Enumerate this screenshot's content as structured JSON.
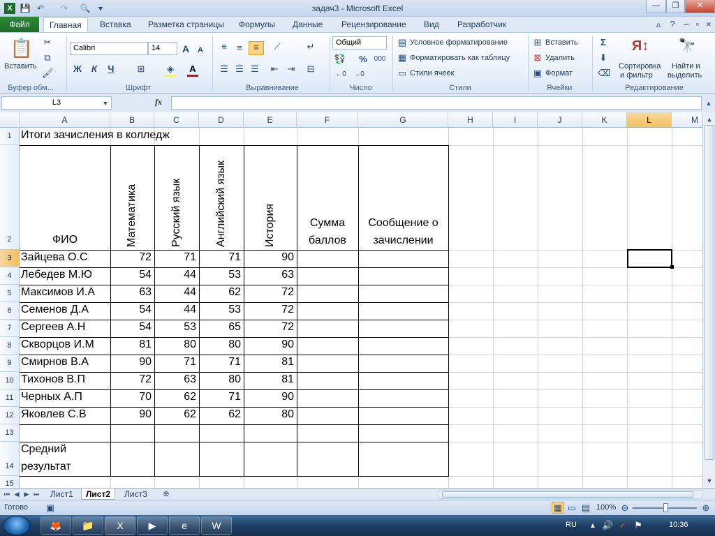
{
  "window": {
    "title": "задач3 - Microsoft Excel",
    "minimize": "—",
    "restore": "❐",
    "close": "✕"
  },
  "ribbon_tabs": [
    "Файл",
    "Главная",
    "Вставка",
    "Разметка страницы",
    "Формулы",
    "Данные",
    "Рецензирование",
    "Вид",
    "Разработчик"
  ],
  "ribbon": {
    "paste_label": "Вставить",
    "clipboard_group": "Буфер обм...",
    "font_name": "Calibri",
    "font_size": "14",
    "grow_font": "A",
    "shrink_font": "A",
    "bold": "Ж",
    "italic": "К",
    "underline": "Ч",
    "font_group": "Шрифт",
    "alignment_group": "Выравнивание",
    "number_format": "Общий",
    "percent": "%",
    "thousands": "000",
    "number_group": "Число",
    "conditional_formatting": "Условное форматирование",
    "format_as_table": "Форматировать как таблицу",
    "cell_styles": "Стили ячеек",
    "styles_group": "Стили",
    "insert_cells": "Вставить",
    "delete_cells": "Удалить",
    "format_cells": "Формат",
    "cells_group": "Ячейки",
    "sort_filter_l1": "Сортировка",
    "sort_filter_l2": "и фильтр",
    "find_select_l1": "Найти и",
    "find_select_l2": "выделить",
    "editing_group": "Редактирование"
  },
  "formula_bar": {
    "name_box": "L3",
    "fx": "fx",
    "value": ""
  },
  "columns": [
    "A",
    "B",
    "C",
    "D",
    "E",
    "F",
    "G",
    "H",
    "I",
    "J",
    "K",
    "L",
    "M"
  ],
  "selected_column": "L",
  "rows": [
    "1",
    "2",
    "3",
    "4",
    "5",
    "6",
    "7",
    "8",
    "9",
    "10",
    "11",
    "12",
    "13",
    "14",
    "15"
  ],
  "sheet": {
    "title": "Итоги зачисления в колледж",
    "headers": {
      "fio": "ФИО",
      "math": "Математика",
      "russian": "Русский язык",
      "english": "Английский язык",
      "history": "История",
      "sum_l1": "Сумма",
      "sum_l2": "баллов",
      "msg_l1": "Сообщение о",
      "msg_l2": "зачислении"
    },
    "students": [
      {
        "name": "Зайцева О.С",
        "scores": [
          "72",
          "71",
          "71",
          "90"
        ]
      },
      {
        "name": "Лебедев М.Ю",
        "scores": [
          "54",
          "44",
          "53",
          "63"
        ]
      },
      {
        "name": "Максимов И.А",
        "scores": [
          "63",
          "44",
          "62",
          "72"
        ]
      },
      {
        "name": "Семенов Д.А",
        "scores": [
          "54",
          "44",
          "53",
          "72"
        ]
      },
      {
        "name": "Сергеев А.Н",
        "scores": [
          "54",
          "53",
          "65",
          "72"
        ]
      },
      {
        "name": "Скворцов И.М",
        "scores": [
          "81",
          "80",
          "80",
          "90"
        ]
      },
      {
        "name": "Смирнов В.А",
        "scores": [
          "90",
          "71",
          "71",
          "81"
        ]
      },
      {
        "name": "Тихонов В.П",
        "scores": [
          "72",
          "63",
          "80",
          "81"
        ]
      },
      {
        "name": "Черных А.П",
        "scores": [
          "70",
          "62",
          "71",
          "90"
        ]
      },
      {
        "name": "Яковлев С.В",
        "scores": [
          "90",
          "62",
          "62",
          "80"
        ]
      }
    ],
    "avg_l1": "Средний",
    "avg_l2": "результат"
  },
  "sheet_tabs": {
    "tab1": "Лист1",
    "tab2": "Лист2",
    "tab3": "Лист3"
  },
  "status": {
    "ready": "Готово",
    "zoom": "100%"
  },
  "taskbar": {
    "lang": "RU",
    "time": "10:36"
  }
}
